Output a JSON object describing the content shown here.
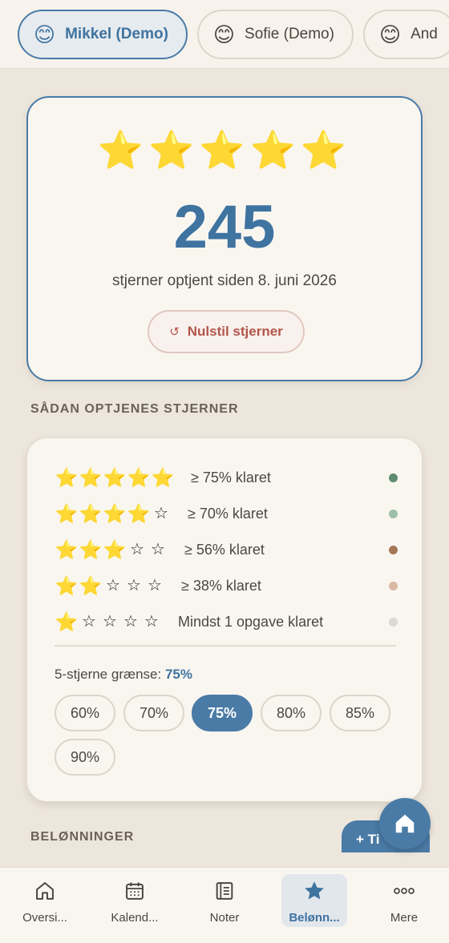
{
  "profiles": [
    {
      "name": "Mikkel (Demo)",
      "icon": "😊",
      "active": true
    },
    {
      "name": "Sofie (Demo)",
      "icon": "😊",
      "active": false
    },
    {
      "name": "And",
      "icon": "😊",
      "active": false
    }
  ],
  "summary": {
    "stars": "⭐⭐⭐⭐⭐",
    "count": "245",
    "subtitle": "stjerner optjent siden 8. juni 2026",
    "reset_icon": "↺",
    "reset_label": "Nulstil stjerner"
  },
  "rules_section": {
    "title": "SÅDAN OPTJENES STJERNER",
    "rules": [
      {
        "filled": 5,
        "label": "≥ 75% klaret",
        "dot_color": "#5e8a6e"
      },
      {
        "filled": 4,
        "label": "≥ 70% klaret",
        "dot_color": "#9cc0a8"
      },
      {
        "filled": 3,
        "label": "≥ 56% klaret",
        "dot_color": "#a67858"
      },
      {
        "filled": 2,
        "label": "≥ 38% klaret",
        "dot_color": "#d9b8a4"
      },
      {
        "filled": 1,
        "label": "Mindst 1 opgave klaret",
        "dot_color": "#dcd8d3"
      }
    ],
    "threshold_label": "5-stjerne grænse: ",
    "threshold_value": "75%",
    "options": [
      "60%",
      "70%",
      "75%",
      "80%",
      "85%",
      "90%"
    ],
    "selected": "75%"
  },
  "rewards_section": {
    "title": "BELØNNINGER",
    "add_label": "+ Ti"
  },
  "colors": {
    "accent": "#4a7ba6",
    "danger": "#b3554b",
    "background": "#ede6dc"
  },
  "nav": [
    {
      "label": "Oversi...",
      "icon": "home-icon",
      "active": false
    },
    {
      "label": "Kalend...",
      "icon": "calendar-icon",
      "active": false
    },
    {
      "label": "Noter",
      "icon": "notes-icon",
      "active": false
    },
    {
      "label": "Belønn...",
      "icon": "star-icon",
      "active": true
    },
    {
      "label": "Mere",
      "icon": "more-icon",
      "active": false
    }
  ]
}
